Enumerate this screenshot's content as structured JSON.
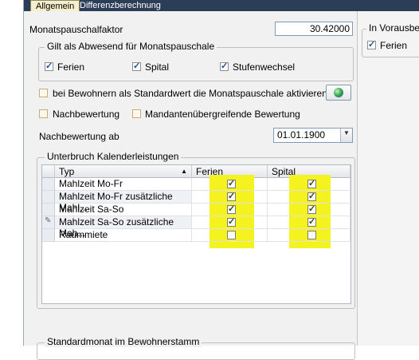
{
  "tabs": {
    "active": "Allgemein",
    "other": "Differenzberechnung"
  },
  "monatspauschalfaktor": {
    "label": "Monatspauschalfaktor",
    "value": "30.42000"
  },
  "abwesend_group": {
    "title": "Gilt als Abwesend für Monatspauschale",
    "ferien": {
      "label": "Ferien",
      "checked": true
    },
    "spital": {
      "label": "Spital",
      "checked": true
    },
    "stufenwechsel": {
      "label": "Stufenwechsel",
      "checked": true
    }
  },
  "bei_bewohnern": {
    "label": "bei Bewohnern als Standardwert die Monatspauschale aktivieren",
    "checked": false
  },
  "nachbewertung": {
    "label": "Nachbewertung",
    "checked": false
  },
  "mandanten": {
    "label": "Mandantenübergreifende Bewertung",
    "checked": false
  },
  "nachbewertung_ab": {
    "label": "Nachbewertung ab",
    "value": "01.01.1900"
  },
  "unterbruch": {
    "title": "Unterbruch Kalenderleistungen",
    "columns": {
      "typ": "Typ",
      "ferien": "Ferien",
      "spital": "Spital"
    },
    "rows": [
      {
        "typ": "Mahlzeit Mo-Fr",
        "ferien": true,
        "spital": true
      },
      {
        "typ": "Mahlzeit Mo-Fr zusätzliche Mahl...",
        "ferien": true,
        "spital": true
      },
      {
        "typ": "Mahlzeit Sa-So",
        "ferien": true,
        "spital": true
      },
      {
        "typ": "Mahlzeit Sa-So zusätzliche Mah...",
        "ferien": true,
        "spital": true
      },
      {
        "typ": "Raummiete",
        "ferien": false,
        "spital": false
      }
    ]
  },
  "standardmonat": {
    "title": "Standardmonat im Bewohnerstamm"
  },
  "vorausbewertung": {
    "title": "In Vorausbew",
    "ferien": {
      "label": "Ferien",
      "checked": true
    }
  },
  "colors": {
    "highlight": "#f4f31f",
    "tabbar": "#2c3e57",
    "active_tab": "#f6efcd"
  }
}
